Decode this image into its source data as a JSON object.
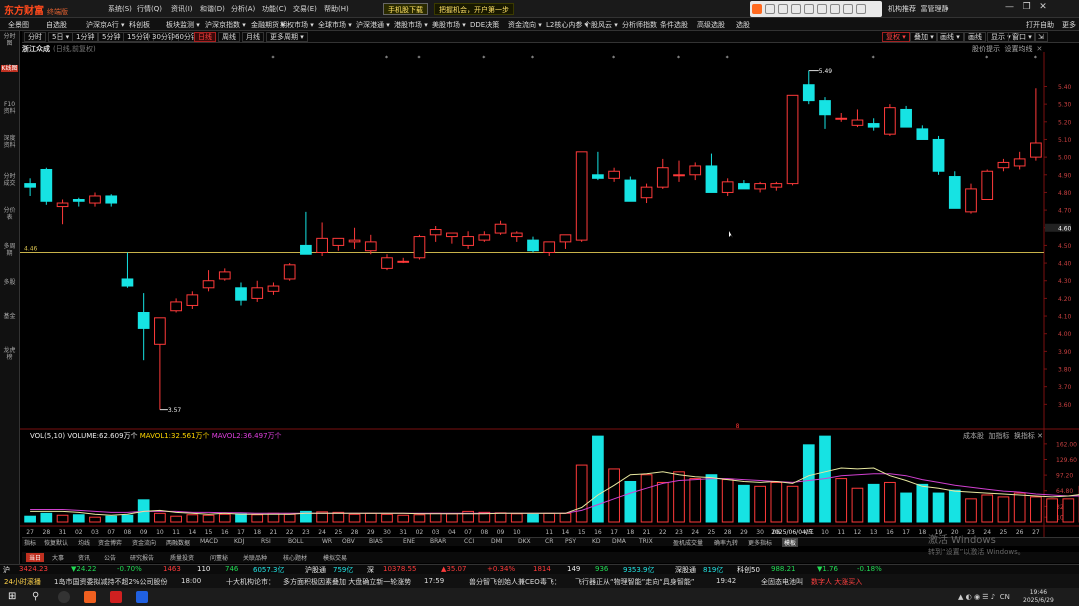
{
  "app": {
    "logo": "东方财富",
    "logo_sub": "终端版"
  },
  "menu": [
    "系统(S)",
    "行情(Q)",
    "资讯(I)",
    "和谐(D)",
    "分析(A)",
    "功能(C)",
    "交易(E)",
    "帮助(H)"
  ],
  "menu_btns": [
    "手机股下载",
    "把握机会，开户第一步"
  ],
  "window": {
    "min": "—",
    "max": "❐",
    "close": "✕"
  },
  "top_right": [
    "机构推荐",
    "富管理静"
  ],
  "nav": [
    "全景图",
    "自选股",
    "沪深京A行 ▾",
    "科创板",
    "板块监测 ▾",
    "沪深京指数 ▾",
    "金融期货 ▾",
    "期权市场 ▾",
    "全球市场 ▾",
    "沪深港通 ▾",
    "港股市场 ▾",
    "美股市场 ▾",
    "DDE决策",
    "资金流向 ▾",
    "L2核心内参 ▾",
    "个股风云 ▾",
    "分析师指数",
    "条件选股",
    "高级选股",
    "选股"
  ],
  "nav_right": [
    "打开自助",
    "更多"
  ],
  "periods": [
    "分时",
    "5日 ▾",
    "1分钟",
    "5分钟",
    "15分钟",
    "30分钟",
    "60分钟",
    "日线",
    "周线",
    "月线",
    "更多周期 ▾"
  ],
  "active_period": "日线",
  "period_right": [
    "复权 ▾",
    "叠加 ▾",
    "画线 ▾",
    "画线",
    "显示 ▾",
    "窗口 ▾",
    "⇲"
  ],
  "left_sidebar": [
    "分时图",
    "K线图",
    "F10资料",
    "深度资料",
    "分时成交",
    "分价表",
    "多周期",
    "多股",
    "基金",
    "龙虎榜"
  ],
  "chart": {
    "stock": "浙江众成",
    "mode": "(日线,前复权)",
    "links": [
      "股价提示",
      "设置均线"
    ],
    "hline_label": "4.46",
    "last_price": "4.60"
  },
  "chart_data": {
    "type": "candlestick",
    "dates": [
      "27",
      "28",
      "31",
      "01",
      "02",
      "03",
      "07",
      "08",
      "09",
      "10",
      "11",
      "14",
      "15",
      "16",
      "17",
      "18",
      "21",
      "22",
      "23",
      "24",
      "25",
      "28",
      "29",
      "30",
      "31",
      "01",
      "02",
      "03",
      "04",
      "05",
      "06",
      "07",
      "08",
      "09",
      "10",
      "11",
      "14",
      "15",
      "16",
      "17",
      "18",
      "21",
      "22",
      "23",
      "24",
      "25",
      "28",
      "29",
      "30",
      "2025/06/04/三",
      "09",
      "10",
      "11",
      "12",
      "13",
      "16",
      "17",
      "18",
      "19",
      "20",
      "23",
      "24",
      "25",
      "26",
      "27"
    ],
    "x_labels": [
      "27",
      "28",
      "31",
      "02",
      "03",
      "07",
      "08",
      "09",
      "10",
      "11",
      "14",
      "15",
      "16",
      "17",
      "18",
      "21",
      "22",
      "23",
      "24",
      "25",
      "28",
      "29",
      "30",
      "31",
      "02",
      "03",
      "04",
      "07",
      "08",
      "09",
      "10",
      "11",
      "14",
      "15",
      "16",
      "17",
      "18",
      "21",
      "22",
      "23",
      "24",
      "25",
      "28",
      "29",
      "30",
      "06",
      "2025/06/04/三",
      "09",
      "10",
      "11",
      "12",
      "13",
      "16",
      "17",
      "18",
      "19",
      "20",
      "23",
      "24",
      "25",
      "26",
      "27"
    ],
    "ylim": [
      3.5,
      5.55
    ],
    "y_ticks": [
      "5.40",
      "5.30",
      "5.20",
      "5.10",
      "5.00",
      "4.90",
      "4.80",
      "4.70",
      "4.60",
      "4.50",
      "4.40",
      "4.30",
      "4.20",
      "4.10",
      "4.00",
      "3.90",
      "3.80",
      "3.70",
      "3.60"
    ],
    "max_label": "5.49",
    "min_label": "3.57",
    "candles": [
      {
        "o": 4.85,
        "h": 4.88,
        "l": 4.78,
        "c": 4.83
      },
      {
        "o": 4.93,
        "h": 4.94,
        "l": 4.73,
        "c": 4.75
      },
      {
        "o": 4.72,
        "h": 4.76,
        "l": 4.62,
        "c": 4.74
      },
      {
        "o": 4.76,
        "h": 4.77,
        "l": 4.72,
        "c": 4.75
      },
      {
        "o": 4.74,
        "h": 4.8,
        "l": 4.72,
        "c": 4.78
      },
      {
        "o": 4.78,
        "h": 4.79,
        "l": 4.72,
        "c": 4.74
      },
      {
        "o": 4.31,
        "h": 4.46,
        "l": 4.26,
        "c": 4.27
      },
      {
        "o": 4.12,
        "h": 4.23,
        "l": 3.85,
        "c": 4.03
      },
      {
        "o": 3.94,
        "h": 4.08,
        "l": 3.57,
        "c": 4.09
      },
      {
        "o": 4.13,
        "h": 4.2,
        "l": 4.12,
        "c": 4.18
      },
      {
        "o": 4.16,
        "h": 4.24,
        "l": 4.14,
        "c": 4.22
      },
      {
        "o": 4.26,
        "h": 4.36,
        "l": 4.24,
        "c": 4.3
      },
      {
        "o": 4.31,
        "h": 4.37,
        "l": 4.3,
        "c": 4.35
      },
      {
        "o": 4.26,
        "h": 4.29,
        "l": 4.16,
        "c": 4.19
      },
      {
        "o": 4.2,
        "h": 4.3,
        "l": 4.18,
        "c": 4.26
      },
      {
        "o": 4.24,
        "h": 4.29,
        "l": 4.22,
        "c": 4.27
      },
      {
        "o": 4.31,
        "h": 4.4,
        "l": 4.3,
        "c": 4.39
      },
      {
        "o": 4.5,
        "h": 4.69,
        "l": 4.45,
        "c": 4.45
      },
      {
        "o": 4.46,
        "h": 4.63,
        "l": 4.44,
        "c": 4.54
      },
      {
        "o": 4.5,
        "h": 4.54,
        "l": 4.47,
        "c": 4.54
      },
      {
        "o": 4.52,
        "h": 4.6,
        "l": 4.48,
        "c": 4.53
      },
      {
        "o": 4.47,
        "h": 4.56,
        "l": 4.45,
        "c": 4.52
      },
      {
        "o": 4.37,
        "h": 4.45,
        "l": 4.36,
        "c": 4.43
      },
      {
        "o": 4.41,
        "h": 4.43,
        "l": 4.4,
        "c": 4.41
      },
      {
        "o": 4.43,
        "h": 4.56,
        "l": 4.42,
        "c": 4.55
      },
      {
        "o": 4.56,
        "h": 4.61,
        "l": 4.52,
        "c": 4.59
      },
      {
        "o": 4.55,
        "h": 4.57,
        "l": 4.51,
        "c": 4.57
      },
      {
        "o": 4.5,
        "h": 4.58,
        "l": 4.48,
        "c": 4.55
      },
      {
        "o": 4.53,
        "h": 4.58,
        "l": 4.52,
        "c": 4.56
      },
      {
        "o": 4.57,
        "h": 4.64,
        "l": 4.56,
        "c": 4.62
      },
      {
        "o": 4.55,
        "h": 4.58,
        "l": 4.52,
        "c": 4.57
      },
      {
        "o": 4.53,
        "h": 4.55,
        "l": 4.46,
        "c": 4.47
      },
      {
        "o": 4.46,
        "h": 4.5,
        "l": 4.44,
        "c": 4.52
      },
      {
        "o": 4.52,
        "h": 4.54,
        "l": 4.48,
        "c": 4.56
      },
      {
        "o": 4.53,
        "h": 4.66,
        "l": 4.52,
        "c": 5.03
      },
      {
        "o": 4.9,
        "h": 5.03,
        "l": 4.87,
        "c": 4.88
      },
      {
        "o": 4.88,
        "h": 4.94,
        "l": 4.86,
        "c": 4.92
      },
      {
        "o": 4.87,
        "h": 4.89,
        "l": 4.75,
        "c": 4.75
      },
      {
        "o": 4.77,
        "h": 4.85,
        "l": 4.74,
        "c": 4.83
      },
      {
        "o": 4.83,
        "h": 4.99,
        "l": 4.82,
        "c": 4.94
      },
      {
        "o": 4.9,
        "h": 4.98,
        "l": 4.86,
        "c": 4.9
      },
      {
        "o": 4.9,
        "h": 4.97,
        "l": 4.87,
        "c": 4.95
      },
      {
        "o": 4.95,
        "h": 5.02,
        "l": 4.8,
        "c": 4.8
      },
      {
        "o": 4.8,
        "h": 4.88,
        "l": 4.78,
        "c": 4.86
      },
      {
        "o": 4.85,
        "h": 4.87,
        "l": 4.82,
        "c": 4.82
      },
      {
        "o": 4.82,
        "h": 4.86,
        "l": 4.8,
        "c": 4.85
      },
      {
        "o": 4.83,
        "h": 4.86,
        "l": 4.81,
        "c": 4.85
      },
      {
        "o": 4.85,
        "h": 5.35,
        "l": 4.84,
        "c": 5.35
      },
      {
        "o": 5.41,
        "h": 5.49,
        "l": 5.3,
        "c": 5.32
      },
      {
        "o": 5.32,
        "h": 5.34,
        "l": 5.16,
        "c": 5.24
      },
      {
        "o": 5.22,
        "h": 5.25,
        "l": 5.2,
        "c": 5.22
      },
      {
        "o": 5.18,
        "h": 5.27,
        "l": 5.17,
        "c": 5.21
      },
      {
        "o": 5.19,
        "h": 5.22,
        "l": 5.15,
        "c": 5.17
      },
      {
        "o": 5.13,
        "h": 5.3,
        "l": 5.12,
        "c": 5.28
      },
      {
        "o": 5.27,
        "h": 5.29,
        "l": 5.17,
        "c": 5.17
      },
      {
        "o": 5.16,
        "h": 5.18,
        "l": 5.1,
        "c": 5.1
      },
      {
        "o": 5.1,
        "h": 5.12,
        "l": 4.9,
        "c": 4.92
      },
      {
        "o": 4.89,
        "h": 4.92,
        "l": 4.71,
        "c": 4.71
      },
      {
        "o": 4.69,
        "h": 4.85,
        "l": 4.68,
        "c": 4.82
      },
      {
        "o": 4.76,
        "h": 4.93,
        "l": 4.76,
        "c": 4.92
      },
      {
        "o": 4.94,
        "h": 4.99,
        "l": 4.92,
        "c": 4.97
      },
      {
        "o": 4.95,
        "h": 5.03,
        "l": 4.93,
        "c": 4.99
      },
      {
        "o": 5.0,
        "h": 5.39,
        "l": 4.98,
        "c": 5.08
      }
    ],
    "volume": {
      "label": "VOL(5,10)",
      "volume": "VOLUME:62.609万个",
      "mavol1": "MAVOL1:32.561万个",
      "mavol2": "MAVOL2:36.497万个",
      "ylim": [
        0,
        170
      ],
      "y_ticks": [
        "162.00",
        "129.60",
        "97.20",
        "64.80",
        "32.40",
        "10.00"
      ],
      "values": [
        12,
        18,
        14,
        15,
        10,
        12,
        14,
        46,
        18,
        12,
        15,
        14,
        16,
        17,
        15,
        18,
        16,
        22,
        21,
        20,
        16,
        18,
        16,
        14,
        15,
        18,
        17,
        22,
        20,
        19,
        17,
        16,
        18,
        18,
        118,
        178,
        110,
        84,
        98,
        82,
        104,
        90,
        98,
        88,
        76,
        74,
        82,
        74,
        160,
        178,
        90,
        70,
        78,
        82,
        60,
        78,
        60,
        66,
        48,
        56,
        52,
        60,
        52,
        48,
        48,
        74
      ],
      "ma5": [
        22,
        22,
        22,
        20,
        16,
        14,
        16,
        22,
        24,
        20,
        18,
        16,
        18,
        16,
        16,
        16,
        16,
        18,
        18,
        18,
        18,
        18,
        18,
        18,
        17,
        17,
        17,
        17,
        17,
        18,
        18,
        18,
        18,
        18,
        30,
        56,
        76,
        98,
        100,
        104,
        98,
        94,
        92,
        88,
        84,
        82,
        84,
        80,
        96,
        104,
        112,
        110,
        112,
        96,
        86,
        74,
        70,
        64,
        62,
        60,
        58,
        56,
        54,
        52,
        54,
        58
      ],
      "ma10": [
        26,
        26,
        26,
        24,
        22,
        20,
        20,
        22,
        22,
        22,
        20,
        20,
        19,
        19,
        18,
        18,
        18,
        18,
        18,
        18,
        18,
        18,
        18,
        18,
        18,
        18,
        18,
        18,
        18,
        18,
        18,
        18,
        18,
        18,
        24,
        36,
        48,
        60,
        70,
        80,
        86,
        88,
        90,
        90,
        88,
        86,
        84,
        82,
        86,
        90,
        96,
        98,
        100,
        100,
        96,
        88,
        82,
        76,
        72,
        68,
        64,
        62,
        58,
        56,
        54,
        54
      ]
    }
  },
  "indicators": [
    "指标",
    "恢复默认",
    "均线",
    "资金博弈",
    "资金流向",
    "两融数据",
    "MACD",
    "KDJ",
    "RSI",
    "BOLL",
    "WR",
    "OBV",
    "BIAS",
    "ENE",
    "BRAR",
    "CCI",
    "DMI",
    "DKX",
    "CR",
    "PSY",
    "KD",
    "DMA",
    "TRIX",
    "盈机成交量",
    "确率九转",
    "更多指标",
    "模板"
  ],
  "sub_tabs": [
    "当日",
    "大事",
    "资讯",
    "公告",
    "研究报告",
    "质量投资",
    "问董秘",
    "关联品种",
    "核心题材",
    "模拟交易"
  ],
  "volume_right": [
    "成本股",
    "加指标",
    "换指标"
  ],
  "ticker": [
    {
      "t": "沪",
      "c": "white"
    },
    {
      "t": "3424.23",
      "c": "red"
    },
    {
      "t": "▼24.22",
      "c": "green"
    },
    {
      "t": "-0.70%",
      "c": "green"
    },
    {
      "t": "1463",
      "c": "red"
    },
    {
      "t": "110",
      "c": "white"
    },
    {
      "t": "746",
      "c": "green"
    },
    {
      "t": "6057.3亿",
      "c": "cyan"
    },
    {
      "t": "沪股通",
      "c": "white"
    },
    {
      "t": "759亿",
      "c": "cyan"
    },
    {
      "t": "深",
      "c": "white"
    },
    {
      "t": "10378.55",
      "c": "red"
    },
    {
      "t": "▲35.07",
      "c": "red"
    },
    {
      "t": "+0.34%",
      "c": "red"
    },
    {
      "t": "1814",
      "c": "red"
    },
    {
      "t": "149",
      "c": "white"
    },
    {
      "t": "936",
      "c": "green"
    },
    {
      "t": "9353.9亿",
      "c": "cyan"
    },
    {
      "t": "深股通",
      "c": "white"
    },
    {
      "t": "819亿",
      "c": "cyan"
    },
    {
      "t": "科创50",
      "c": "white"
    },
    {
      "t": "988.21",
      "c": "green"
    },
    {
      "t": "▼1.76",
      "c": "green"
    },
    {
      "t": "-0.18%",
      "c": "green"
    }
  ],
  "news": [
    "24小时滚播",
    "1岛市国资委拟减持不超2%公司股份",
    "18:00",
    "十大机构论市：",
    "多方面积极因素叠加 大盘确立新一轮涨势",
    "17:59",
    "兽分智飞创始人兼CEO毒飞：",
    "飞行器正从“物理智能”走向“具身智能”",
    "19:42",
    "全固态电池叫",
    "数字人 大涨买入"
  ],
  "watermark": {
    "title": "激活 Windows",
    "sub": "转到“设置”以激活 Windows。"
  },
  "clock": {
    "time": "19:46",
    "date": "2025/6/29",
    "lang": "CN",
    "sys_time": "19:46:23"
  }
}
